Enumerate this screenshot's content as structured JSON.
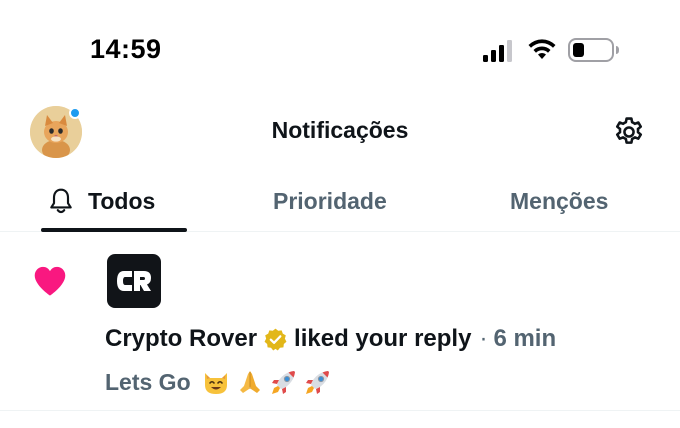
{
  "status_bar": {
    "time": "14:59"
  },
  "header": {
    "title": "Notificações",
    "avatar_icon": "kitten-avatar",
    "settings_icon": "gear-icon"
  },
  "tabs": [
    {
      "label": "Todos",
      "active": true,
      "icon": "bell-icon"
    },
    {
      "label": "Prioridade",
      "active": false
    },
    {
      "label": "Menções",
      "active": false
    }
  ],
  "notification": {
    "type_icon": "heart-icon",
    "user": "Crypto Rover",
    "verified": true,
    "action": "liked your reply",
    "separator": "·",
    "time": "6 min",
    "text": "Lets Go",
    "emojis": [
      "smiling-cat-emoji",
      "folded-hands-emoji",
      "rocket-emoji",
      "rocket-emoji"
    ]
  },
  "colors": {
    "primary_text": "#0f1419",
    "secondary_text": "#536471",
    "like_pink": "#f91880",
    "accent_blue": "#1d9bf0",
    "verified_gold": "#e2b719"
  }
}
